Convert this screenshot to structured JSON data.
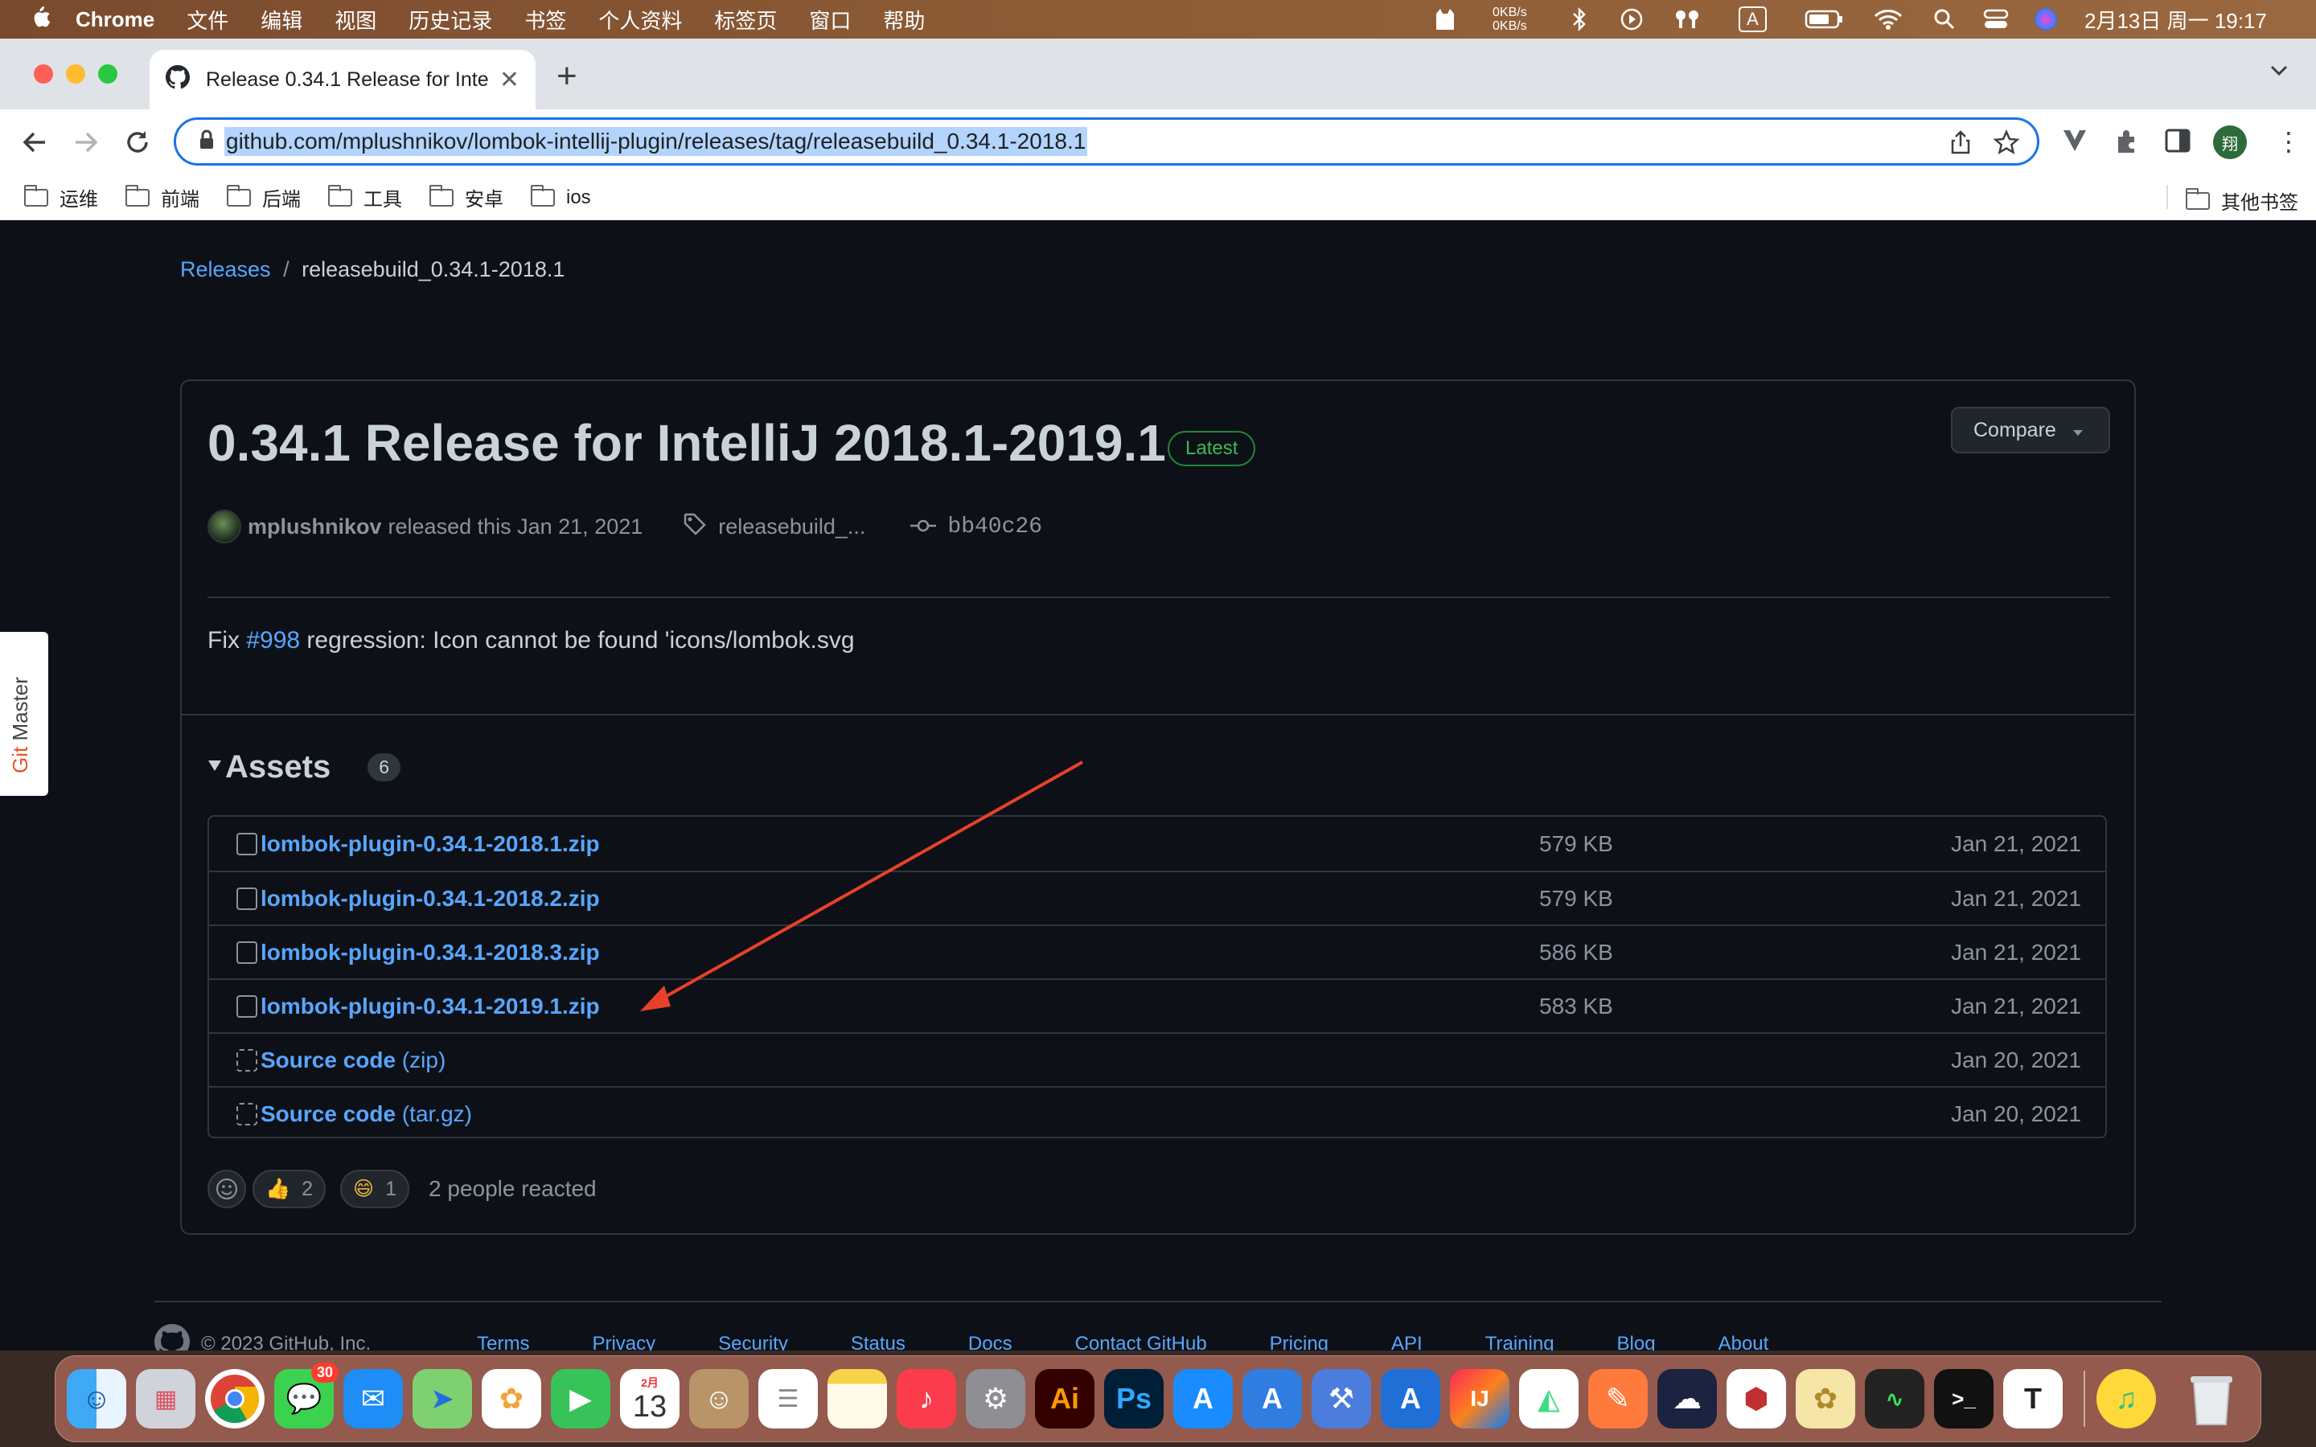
{
  "menubar": {
    "apple": "",
    "app": "Chrome",
    "items": [
      "文件",
      "编辑",
      "视图",
      "历史记录",
      "书签",
      "个人资料",
      "标签页",
      "窗口",
      "帮助"
    ],
    "net_up": "0KB/s",
    "net_down": "0KB/s",
    "input_method": "A",
    "datetime": "2月13日 周一  19:17"
  },
  "browser": {
    "tab_title": "Release 0.34.1 Release for Inte",
    "new_tab": "+",
    "url": "github.com/mplushnikov/lombok-intellij-plugin/releases/tag/releasebuild_0.34.1-2018.1",
    "profile_initial": "翔",
    "bookmarks": [
      "运维",
      "前端",
      "后端",
      "工具",
      "安卓",
      "ios"
    ],
    "other_bookmarks": "其他书签"
  },
  "side_tab": {
    "label_git": "Git",
    "label_master": "Master"
  },
  "breadcrumb": {
    "releases": "Releases",
    "separator": "/",
    "current": "releasebuild_0.34.1-2018.1"
  },
  "release": {
    "title": "0.34.1 Release for IntelliJ 2018.1-2019.1",
    "badge": "Latest",
    "compare": "Compare",
    "author": "mplushnikov",
    "released_text": "released this Jan 21, 2021",
    "tag": "releasebuild_...",
    "commit": "bb40c26",
    "body_prefix": "Fix ",
    "issue_link": "#998",
    "body_suffix": " regression: Icon cannot be found 'icons/lombok.svg"
  },
  "assets": {
    "heading": "Assets",
    "count": "6",
    "rows": [
      {
        "name": "lombok-plugin-0.34.1-2018.1.zip",
        "size": "579 KB",
        "date": "Jan 21, 2021"
      },
      {
        "name": "lombok-plugin-0.34.1-2018.2.zip",
        "size": "579 KB",
        "date": "Jan 21, 2021"
      },
      {
        "name": "lombok-plugin-0.34.1-2018.3.zip",
        "size": "586 KB",
        "date": "Jan 21, 2021"
      },
      {
        "name": "lombok-plugin-0.34.1-2019.1.zip",
        "size": "583 KB",
        "date": "Jan 21, 2021"
      },
      {
        "name": "Source code",
        "suffix": "(zip)",
        "size": "",
        "date": "Jan 20, 2021"
      },
      {
        "name": "Source code",
        "suffix": "(tar.gz)",
        "size": "",
        "date": "Jan 20, 2021"
      }
    ]
  },
  "reactions": {
    "thumbs_count": "2",
    "laugh_count": "1",
    "summary": "2 people reacted"
  },
  "footer": {
    "copyright": "© 2023 GitHub, Inc.",
    "links": [
      "Terms",
      "Privacy",
      "Security",
      "Status",
      "Docs",
      "Contact GitHub",
      "Pricing",
      "API",
      "Training",
      "Blog",
      "About"
    ]
  },
  "dock": {
    "calendar_month": "2月",
    "calendar_day": "13",
    "messages_badge": "30"
  },
  "colors": {
    "link": "#58a6ff",
    "latest": "#3fb950",
    "annotation_arrow": "#e8402a",
    "page_bg": "#0d1117"
  }
}
